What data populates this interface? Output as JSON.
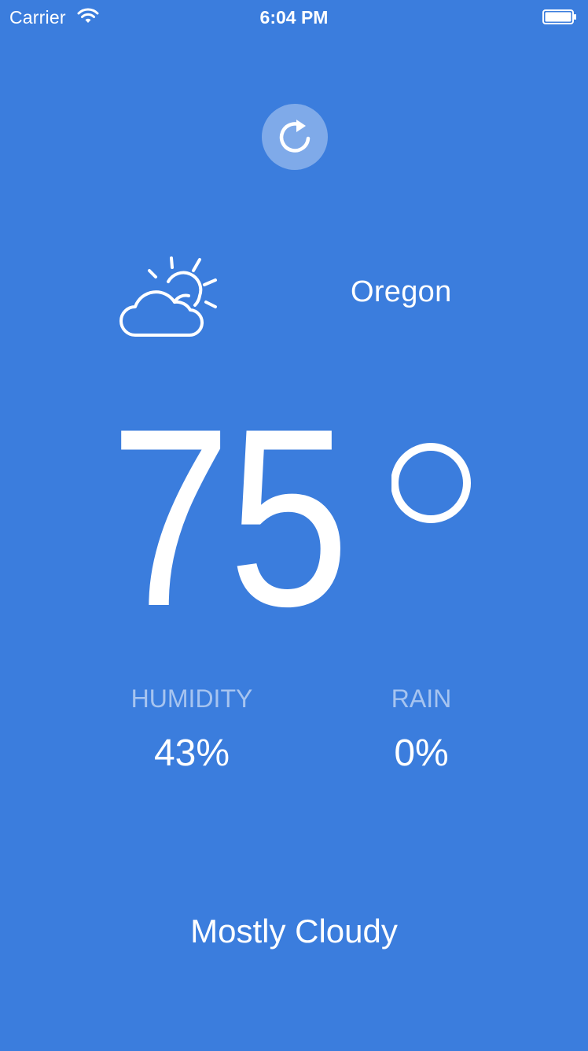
{
  "status_bar": {
    "carrier": "Carrier",
    "time": "6:04 PM",
    "wifi_icon": "wifi-icon",
    "battery_icon": "battery-icon"
  },
  "refresh": {
    "icon": "refresh-icon"
  },
  "weather": {
    "icon": "partly-cloudy-icon",
    "location": "Oregon",
    "temperature": "75",
    "condition": "Mostly Cloudy"
  },
  "stats": {
    "humidity_label": "HUMIDITY",
    "humidity_value": "43%",
    "rain_label": "RAIN",
    "rain_value": "0%"
  },
  "colors": {
    "background": "#3b7ddd",
    "text": "#ffffff"
  }
}
